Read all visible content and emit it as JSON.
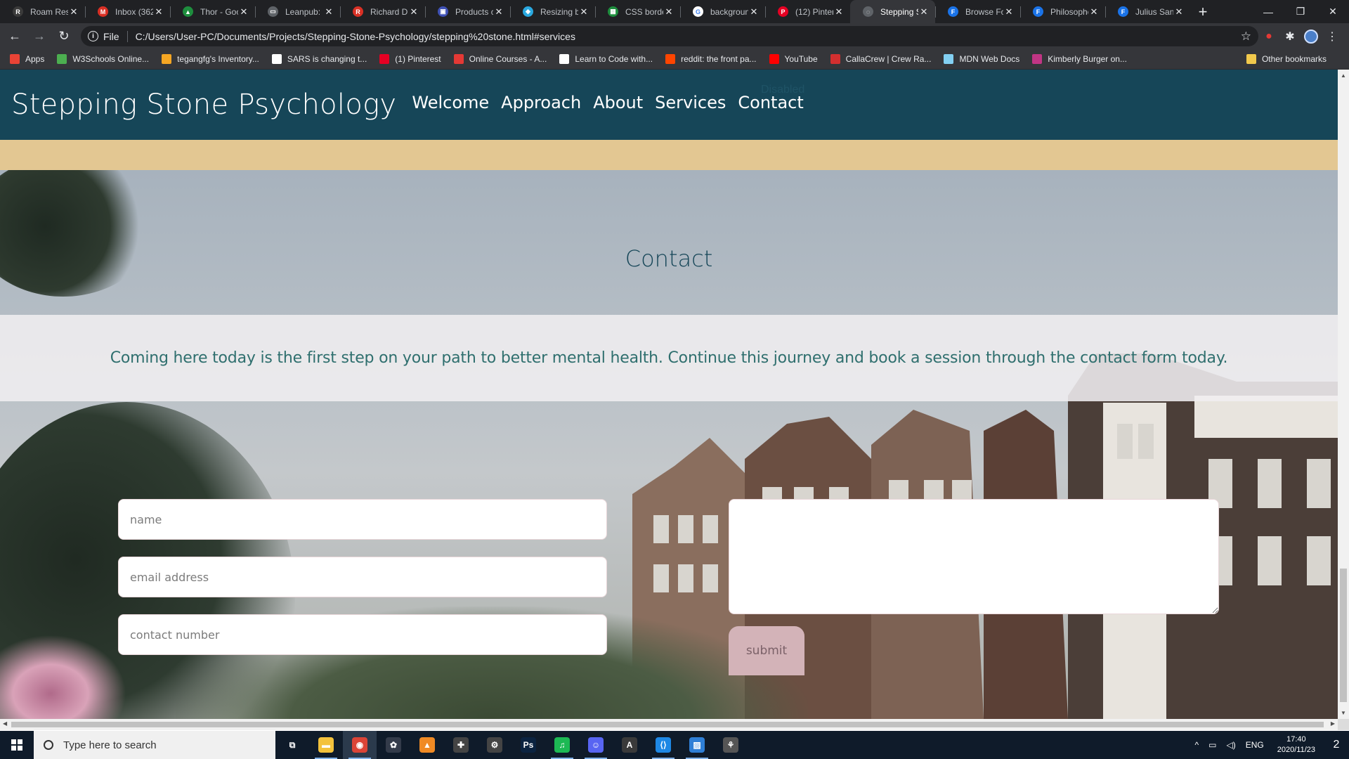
{
  "browser": {
    "tabs": [
      {
        "title": "Roam Rese",
        "fav_color": "#3a3a3a",
        "fav_glyph": "R",
        "active": false
      },
      {
        "title": "Inbox (362",
        "fav_color": "#d93025",
        "fav_glyph": "M",
        "active": false
      },
      {
        "title": "Thor - Goo",
        "fav_color": "#1e8e3e",
        "fav_glyph": "▲",
        "active": false
      },
      {
        "title": "Leanpub: I",
        "fav_color": "#5f6368",
        "fav_glyph": "▭",
        "active": false
      },
      {
        "title": "Richard D.",
        "fav_color": "#d93025",
        "fav_glyph": "R",
        "active": false
      },
      {
        "title": "Products c",
        "fav_color": "#3f51b5",
        "fav_glyph": "▣",
        "active": false
      },
      {
        "title": "Resizing b",
        "fav_color": "#2aa9e0",
        "fav_glyph": "◆",
        "active": false
      },
      {
        "title": "CSS borde",
        "fav_color": "#1e8e3e",
        "fav_glyph": "▦",
        "active": false
      },
      {
        "title": "backgroun",
        "fav_color": "#ffffff",
        "fav_glyph": "G",
        "active": false
      },
      {
        "title": "(12) Pinter",
        "fav_color": "#e60023",
        "fav_glyph": "P",
        "active": false
      },
      {
        "title": "Stepping S",
        "fav_color": "#5f6368",
        "fav_glyph": "◌",
        "active": true
      },
      {
        "title": "Browse Fo",
        "fav_color": "#1a73e8",
        "fav_glyph": "F",
        "active": false
      },
      {
        "title": "Philosophe",
        "fav_color": "#1a73e8",
        "fav_glyph": "F",
        "active": false
      },
      {
        "title": "Julius Sans",
        "fav_color": "#1a73e8",
        "fav_glyph": "F",
        "active": false
      }
    ],
    "new_tab": "+",
    "window_controls": {
      "minimize": "—",
      "maximize": "❐",
      "close": "✕"
    },
    "nav": {
      "back": "←",
      "forward": "→",
      "reload": "↻"
    },
    "address": {
      "info_glyph": "i",
      "scheme": "File",
      "url": "C:/Users/User-PC/Documents/Projects/Stepping-Stone-Psychology/stepping%20stone.html#services",
      "star": "☆"
    },
    "extensions": [
      "●",
      "✱"
    ],
    "menu": "⋮",
    "bookmarks": [
      {
        "label": "Apps",
        "color": "#ea4335"
      },
      {
        "label": "W3Schools Online...",
        "color": "#4caf50"
      },
      {
        "label": "tegangfg's Inventory...",
        "color": "#f5a623"
      },
      {
        "label": "SARS is changing t...",
        "color": "#ffffff"
      },
      {
        "label": "(1) Pinterest",
        "color": "#e60023"
      },
      {
        "label": "Online Courses - A...",
        "color": "#e53935"
      },
      {
        "label": "Learn to Code with...",
        "color": "#ffffff"
      },
      {
        "label": "reddit: the front pa...",
        "color": "#ff4500"
      },
      {
        "label": "YouTube",
        "color": "#ff0000"
      },
      {
        "label": "CallaCrew | Crew Ra...",
        "color": "#d32f2f"
      },
      {
        "label": "MDN Web Docs",
        "color": "#83d0f2"
      },
      {
        "label": "Kimberly Burger on...",
        "color": "#c13584"
      }
    ],
    "other_bookmarks": "Other bookmarks"
  },
  "site": {
    "brand": "Stepping Stone Psychology",
    "menu": [
      "Welcome",
      "Approach",
      "About",
      "Services",
      "Contact"
    ],
    "ghost_text": "Disabled",
    "section_title": "Contact",
    "blurb": "Coming here today is the first step on your path to better mental health. Continue this journey and book a session through the contact form today.",
    "form": {
      "name_placeholder": "name",
      "email_placeholder": "email address",
      "phone_placeholder": "contact number",
      "message_placeholder": "",
      "submit_label": "submit"
    },
    "colors": {
      "nav": "#164658",
      "gold": "#e3c792",
      "title": "#164658",
      "blurb": "#2f6f6e",
      "submit": "#d3b3b8"
    }
  },
  "taskbar": {
    "search_placeholder": "Type here to search",
    "apps": [
      {
        "name": "task-view",
        "glyph": "⧉",
        "color": "transparent"
      },
      {
        "name": "file-explorer",
        "glyph": "▬",
        "color": "#f3c23c"
      },
      {
        "name": "chrome",
        "glyph": "◉",
        "color": "#db4437"
      },
      {
        "name": "davinci-resolve",
        "glyph": "✿",
        "color": "#333b4a"
      },
      {
        "name": "vlc",
        "glyph": "▲",
        "color": "#f08a24"
      },
      {
        "name": "game-controller",
        "glyph": "✚",
        "color": "#444"
      },
      {
        "name": "steam-tool",
        "glyph": "⚙",
        "color": "#444"
      },
      {
        "name": "photoshop",
        "glyph": "Ps",
        "color": "#0b2340"
      },
      {
        "name": "spotify",
        "glyph": "♫",
        "color": "#1db954"
      },
      {
        "name": "discord",
        "glyph": "☺",
        "color": "#5865f2"
      },
      {
        "name": "acrobat",
        "glyph": "A",
        "color": "#3a3a3a"
      },
      {
        "name": "vscode",
        "glyph": "⟨⟩",
        "color": "#1e88e5"
      },
      {
        "name": "photos",
        "glyph": "▨",
        "color": "#2f7fd6"
      },
      {
        "name": "app-extra",
        "glyph": "⚘",
        "color": "#555"
      }
    ],
    "tray": {
      "chevron": "^",
      "network": "▭",
      "volume": "◁)",
      "language": "ENG"
    },
    "time": "17:40",
    "date": "2020/11/23",
    "notification_count": "2"
  }
}
